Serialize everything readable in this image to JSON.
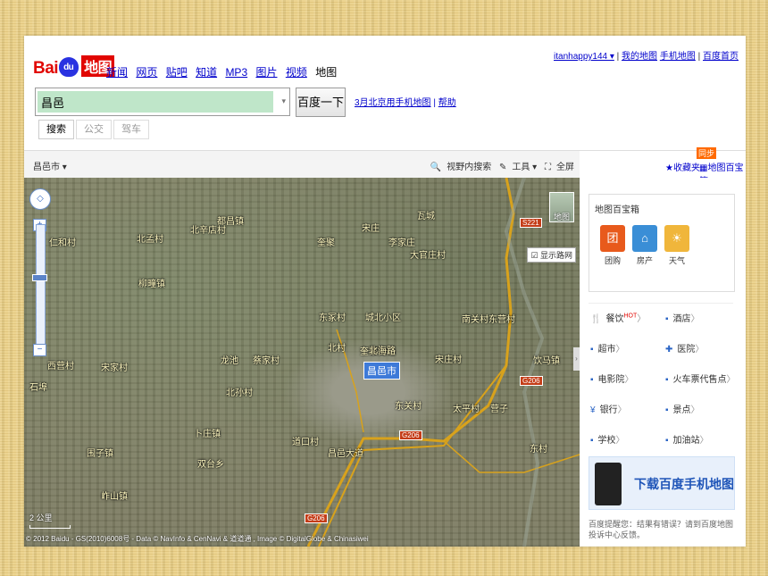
{
  "logo": {
    "bai": "Bai",
    "du": "",
    "ditu": "地图"
  },
  "nav": {
    "links": [
      "新闻",
      "网页",
      "贴吧",
      "知道",
      "MP3",
      "图片",
      "视频"
    ],
    "current": "地图"
  },
  "userbar": {
    "user": "itanhappy144 ▾",
    "sep1": "|",
    "map_mine": "我的地图",
    "phone_map": "手机地图",
    "sep2": "|",
    "home": "百度首页"
  },
  "search": {
    "value": "昌邑",
    "button": "百度一下",
    "dropdown": "▾"
  },
  "promo": {
    "link": "3月北京用手机地图",
    "sep": "|",
    "help": "帮助"
  },
  "modes": {
    "search": "搜索",
    "bus": "公交",
    "drive": "驾车"
  },
  "toolbar": {
    "city": "昌邑市 ▾",
    "view_search": "视野内搜索",
    "tools": "工具 ▾",
    "fullscreen": "全屏"
  },
  "right_toolbar": {
    "favorites": "收藏夹",
    "toolbox": "地图百宝箱",
    "badge": "同步"
  },
  "map": {
    "city_label": "昌邑市",
    "labels": [
      {
        "text": "都昌镇"
      },
      {
        "text": "北辛店村"
      },
      {
        "text": "北孟村"
      },
      {
        "text": "仁和村"
      },
      {
        "text": "宋庄"
      },
      {
        "text": "瓦城"
      },
      {
        "text": "城北小区"
      },
      {
        "text": "东冢村"
      },
      {
        "text": "营子"
      },
      {
        "text": "北村"
      },
      {
        "text": "东营村"
      },
      {
        "text": "李家庄"
      },
      {
        "text": "大官庄村"
      },
      {
        "text": "南关村"
      },
      {
        "text": "龙池"
      },
      {
        "text": "西营村"
      },
      {
        "text": "柳疃镇"
      },
      {
        "text": "蔡家村"
      },
      {
        "text": "宋家村"
      },
      {
        "text": "卜庄镇"
      },
      {
        "text": "奎聚街道"
      },
      {
        "text": "宋庄村"
      },
      {
        "text": "饮马镇"
      },
      {
        "text": "围子镇"
      },
      {
        "text": "北海路"
      },
      {
        "text": "昌邑大道"
      },
      {
        "text": "道口村"
      },
      {
        "text": "东关村"
      },
      {
        "text": "岞山镇"
      },
      {
        "text": "双台乡"
      },
      {
        "text": "北孙村"
      },
      {
        "text": "奎聚"
      },
      {
        "text": "太平村"
      },
      {
        "text": "东村"
      },
      {
        "text": "石埠"
      }
    ],
    "shields": [
      {
        "text": "S221"
      },
      {
        "text": "G206"
      },
      {
        "text": "G206"
      },
      {
        "text": "G206"
      }
    ],
    "map_type": "地图",
    "road_net": "显示路网",
    "scale": "2 公里",
    "copyright": "© 2012 Baidu - GS(2010)6008号 - Data © NavInfo & CenNavi & 道道通 , Image © DigitalGlobe & Chinasiwei",
    "pan": "◇",
    "zoom_in": "+",
    "zoom_out": "−"
  },
  "panel": {
    "title": "地图百宝箱",
    "tools": [
      {
        "label": "团购",
        "icon": "团"
      },
      {
        "label": "房产",
        "icon": "⌂"
      },
      {
        "label": "天气",
        "icon": "☀"
      }
    ],
    "categories": [
      {
        "icon": "🍴",
        "label": "餐饮",
        "hot": "HOT"
      },
      {
        "icon": "▪",
        "label": "酒店"
      },
      {
        "icon": "▪",
        "label": "超市"
      },
      {
        "icon": "✚",
        "label": "医院"
      },
      {
        "icon": "▪",
        "label": "电影院"
      },
      {
        "icon": "▪",
        "label": "火车票代售点"
      },
      {
        "icon": "¥",
        "label": "银行"
      },
      {
        "icon": "▪",
        "label": "景点"
      },
      {
        "icon": "▪",
        "label": "学校"
      },
      {
        "icon": "▪",
        "label": "加油站"
      }
    ],
    "arrow": "〉",
    "app_banner": "下载百度手机地图",
    "tip": "百度提醒您：结果有错误？请到百度地图投诉中心反馈。"
  },
  "colors": {
    "accent": "#2932e1",
    "brand_red": "#e10601",
    "link": "#0000cc",
    "frame_bg": "#e9cf86"
  }
}
